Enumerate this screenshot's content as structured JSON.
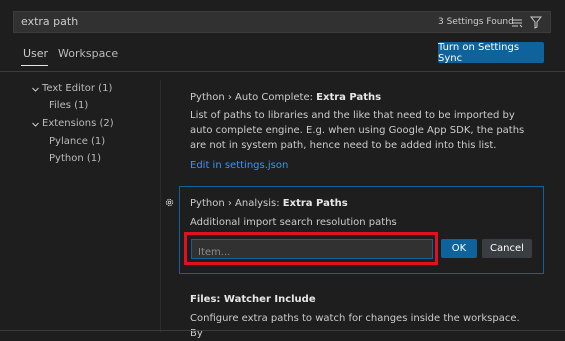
{
  "search": {
    "value": "extra path",
    "results_count": "3 Settings Found",
    "icons": [
      "filter-lines-icon",
      "funnel-icon"
    ]
  },
  "tabs": [
    {
      "label": "User",
      "active": true
    },
    {
      "label": "Workspace",
      "active": false
    }
  ],
  "sync_button": "Turn on Settings Sync",
  "toc": [
    {
      "label": "Text Editor (1)",
      "expanded": true
    },
    {
      "label": "Files (1)"
    },
    {
      "label": "Extensions (2)",
      "expanded": true
    },
    {
      "label": "Pylance (1)"
    },
    {
      "label": "Python (1)"
    }
  ],
  "settings": [
    {
      "category": "Python › Auto Complete: ",
      "name": "Extra Paths",
      "description": "List of paths to libraries and the like that need to be imported by auto complete engine. E.g. when using Google App SDK, the paths are not in system path, hence need to be added into this list.",
      "link": "Edit in settings.json"
    },
    {
      "category": "Python › Analysis: ",
      "name": "Extra Paths",
      "description": "Additional import search resolution paths",
      "input_placeholder": "Item...",
      "ok_label": "OK",
      "cancel_label": "Cancel"
    },
    {
      "category": "Files: ",
      "name": "Watcher Include",
      "description": "Configure extra paths to watch for changes inside the workspace. By"
    }
  ],
  "colors": {
    "background": "#1e1e1e",
    "accent": "#0e639c",
    "link": "#3794ff",
    "highlight_box": "#e0101f"
  }
}
